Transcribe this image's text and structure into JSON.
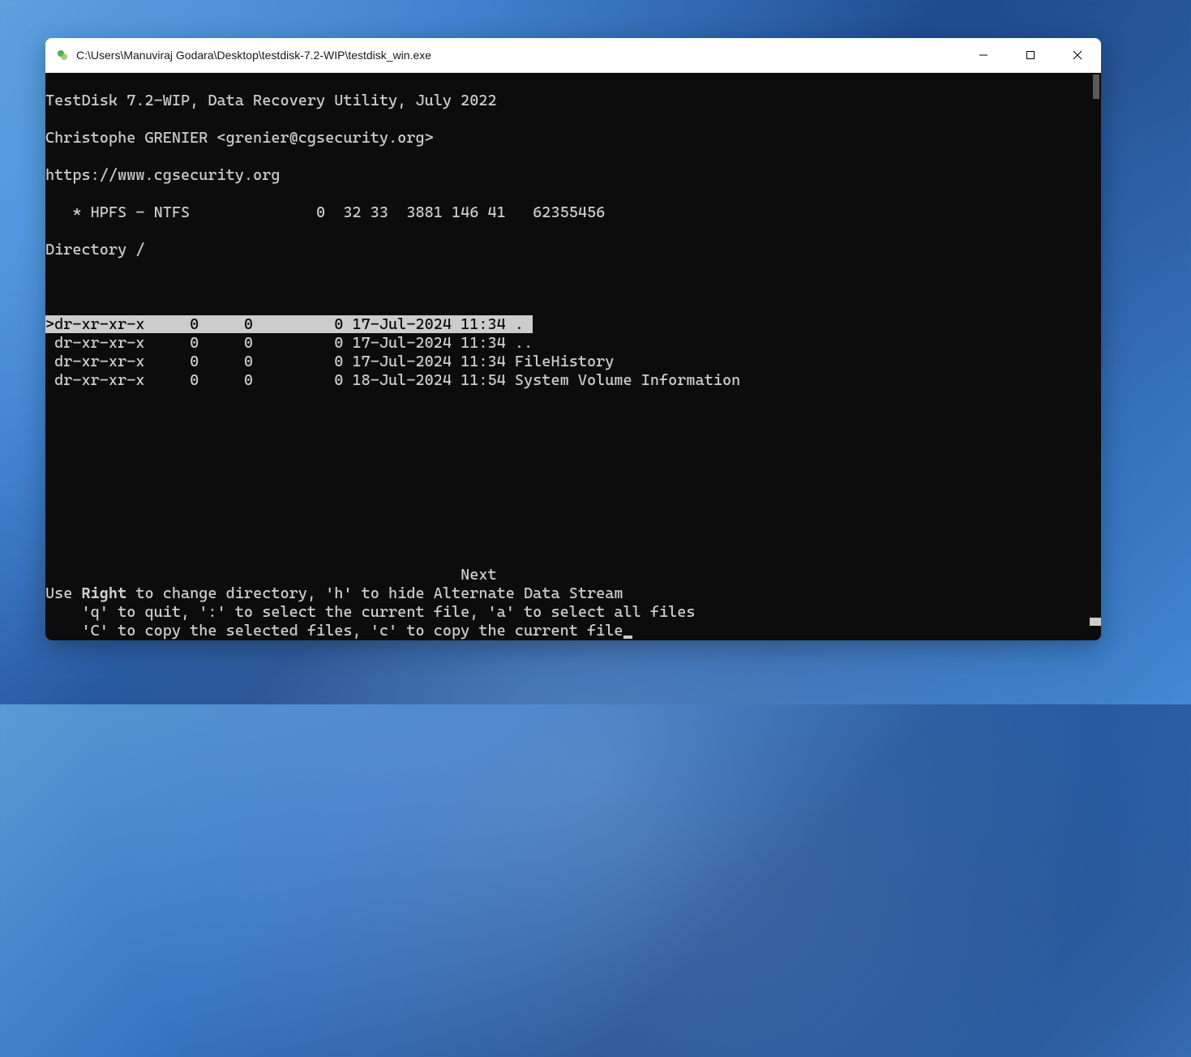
{
  "window": {
    "title": "C:\\Users\\Manuviraj Godara\\Desktop\\testdisk-7.2-WIP\\testdisk_win.exe"
  },
  "terminal": {
    "header_line1": "TestDisk 7.2-WIP, Data Recovery Utility, July 2022",
    "header_line2": "Christophe GRENIER <grenier@cgsecurity.org>",
    "header_line3": "https://www.cgsecurity.org",
    "partition_line": "   * HPFS - NTFS              0  32 33  3881 146 41   62355456",
    "directory_label": "Directory /",
    "files": [
      {
        "selected": true,
        "prefix": ">",
        "perms": "dr-xr-xr-x",
        "uid": "0",
        "gid": "0",
        "size": "0",
        "date": "17-Jul-2024",
        "time": "11:34",
        "name": "."
      },
      {
        "selected": false,
        "prefix": " ",
        "perms": "dr-xr-xr-x",
        "uid": "0",
        "gid": "0",
        "size": "0",
        "date": "17-Jul-2024",
        "time": "11:34",
        "name": ".."
      },
      {
        "selected": false,
        "prefix": " ",
        "perms": "dr-xr-xr-x",
        "uid": "0",
        "gid": "0",
        "size": "0",
        "date": "17-Jul-2024",
        "time": "11:34",
        "name": "FileHistory"
      },
      {
        "selected": false,
        "prefix": " ",
        "perms": "dr-xr-xr-x",
        "uid": "0",
        "gid": "0",
        "size": "0",
        "date": "18-Jul-2024",
        "time": "11:54",
        "name": "System Volume Information"
      }
    ],
    "next_label": "                                              Next",
    "help_line1_prefix": "Use ",
    "help_line1_bold": "Right",
    "help_line1_suffix": " to change directory, 'h' to hide Alternate Data Stream",
    "help_line2": "    'q' to quit, ':' to select the current file, 'a' to select all files",
    "help_line3": "    'C' to copy the selected files, 'c' to copy the current file"
  }
}
